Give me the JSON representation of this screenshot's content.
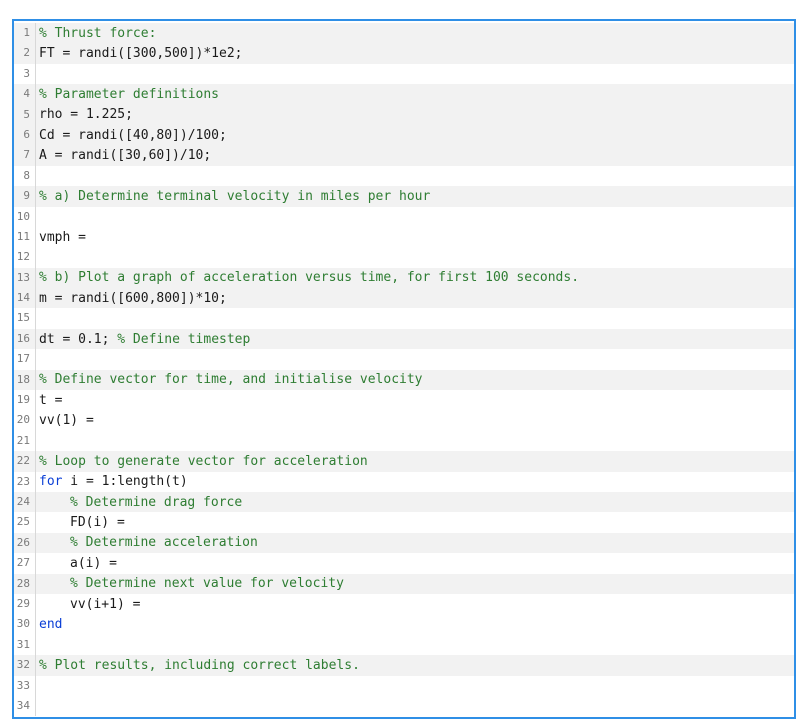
{
  "colors": {
    "border_accent": "#2f8fe6",
    "comment": "#2e7d32",
    "keyword": "#0b3fd6",
    "text": "#1a1a1a",
    "shaded_line": "#f2f2f2"
  },
  "editor": {
    "lines": [
      {
        "num": "1",
        "text": "% Thrust force:",
        "kind": "comment",
        "indent": 0,
        "shaded": true
      },
      {
        "num": "2",
        "text": "FT = randi([300,500])*1e2;",
        "kind": "code",
        "indent": 0,
        "shaded": true
      },
      {
        "num": "3",
        "text": "",
        "kind": "code",
        "indent": 0,
        "shaded": false
      },
      {
        "num": "4",
        "text": "% Parameter definitions",
        "kind": "comment",
        "indent": 0,
        "shaded": true
      },
      {
        "num": "5",
        "text": "rho = 1.225;",
        "kind": "code",
        "indent": 0,
        "shaded": true
      },
      {
        "num": "6",
        "text": "Cd = randi([40,80])/100;",
        "kind": "code",
        "indent": 0,
        "shaded": true
      },
      {
        "num": "7",
        "text": "A = randi([30,60])/10;",
        "kind": "code",
        "indent": 0,
        "shaded": true
      },
      {
        "num": "8",
        "text": "",
        "kind": "code",
        "indent": 0,
        "shaded": false
      },
      {
        "num": "9",
        "text": "% a) Determine terminal velocity in miles per hour",
        "kind": "comment",
        "indent": 0,
        "shaded": true
      },
      {
        "num": "10",
        "text": "",
        "kind": "code",
        "indent": 0,
        "shaded": false
      },
      {
        "num": "11",
        "text": "vmph =",
        "kind": "code",
        "indent": 0,
        "shaded": false
      },
      {
        "num": "12",
        "text": "",
        "kind": "code",
        "indent": 0,
        "shaded": false
      },
      {
        "num": "13",
        "text": "% b) Plot a graph of acceleration versus time, for first 100 seconds.",
        "kind": "comment",
        "indent": 0,
        "shaded": true
      },
      {
        "num": "14",
        "text": "m = randi([600,800])*10;",
        "kind": "code",
        "indent": 0,
        "shaded": true
      },
      {
        "num": "15",
        "text": "",
        "kind": "code",
        "indent": 0,
        "shaded": false
      },
      {
        "num": "16",
        "text": "dt = 0.1;",
        "comment": " % Define timestep",
        "kind": "mixed",
        "indent": 0,
        "shaded": true
      },
      {
        "num": "17",
        "text": "",
        "kind": "code",
        "indent": 0,
        "shaded": false
      },
      {
        "num": "18",
        "text": "% Define vector for time, and initialise velocity",
        "kind": "comment",
        "indent": 0,
        "shaded": true
      },
      {
        "num": "19",
        "text": "t =",
        "kind": "code",
        "indent": 0,
        "shaded": false
      },
      {
        "num": "20",
        "text": "vv(1) =",
        "kind": "code",
        "indent": 0,
        "shaded": false
      },
      {
        "num": "21",
        "text": "",
        "kind": "code",
        "indent": 0,
        "shaded": false
      },
      {
        "num": "22",
        "text": "% Loop to generate vector for acceleration",
        "kind": "comment",
        "indent": 0,
        "shaded": true
      },
      {
        "num": "23",
        "keyword": "for",
        "text": " i = 1:length(t)",
        "kind": "keyword-line",
        "indent": 0,
        "shaded": false
      },
      {
        "num": "24",
        "text": "% Determine drag force",
        "kind": "comment",
        "indent": 1,
        "shaded": true
      },
      {
        "num": "25",
        "text": "FD(i) =",
        "kind": "code",
        "indent": 1,
        "shaded": false
      },
      {
        "num": "26",
        "text": "% Determine acceleration",
        "kind": "comment",
        "indent": 1,
        "shaded": true
      },
      {
        "num": "27",
        "text": "a(i) =",
        "kind": "code",
        "indent": 1,
        "shaded": false
      },
      {
        "num": "28",
        "text": "% Determine next value for velocity",
        "kind": "comment",
        "indent": 1,
        "shaded": true
      },
      {
        "num": "29",
        "text": "vv(i+1) =",
        "kind": "code",
        "indent": 1,
        "shaded": false
      },
      {
        "num": "30",
        "keyword": "end",
        "text": "",
        "kind": "keyword-line",
        "indent": 0,
        "shaded": false
      },
      {
        "num": "31",
        "text": "",
        "kind": "code",
        "indent": 0,
        "shaded": false
      },
      {
        "num": "32",
        "text": "% Plot results, including correct labels.",
        "kind": "comment",
        "indent": 0,
        "shaded": true
      },
      {
        "num": "33",
        "text": "",
        "kind": "code",
        "indent": 0,
        "shaded": false
      },
      {
        "num": "34",
        "text": "",
        "kind": "code",
        "indent": 0,
        "shaded": false
      }
    ]
  }
}
